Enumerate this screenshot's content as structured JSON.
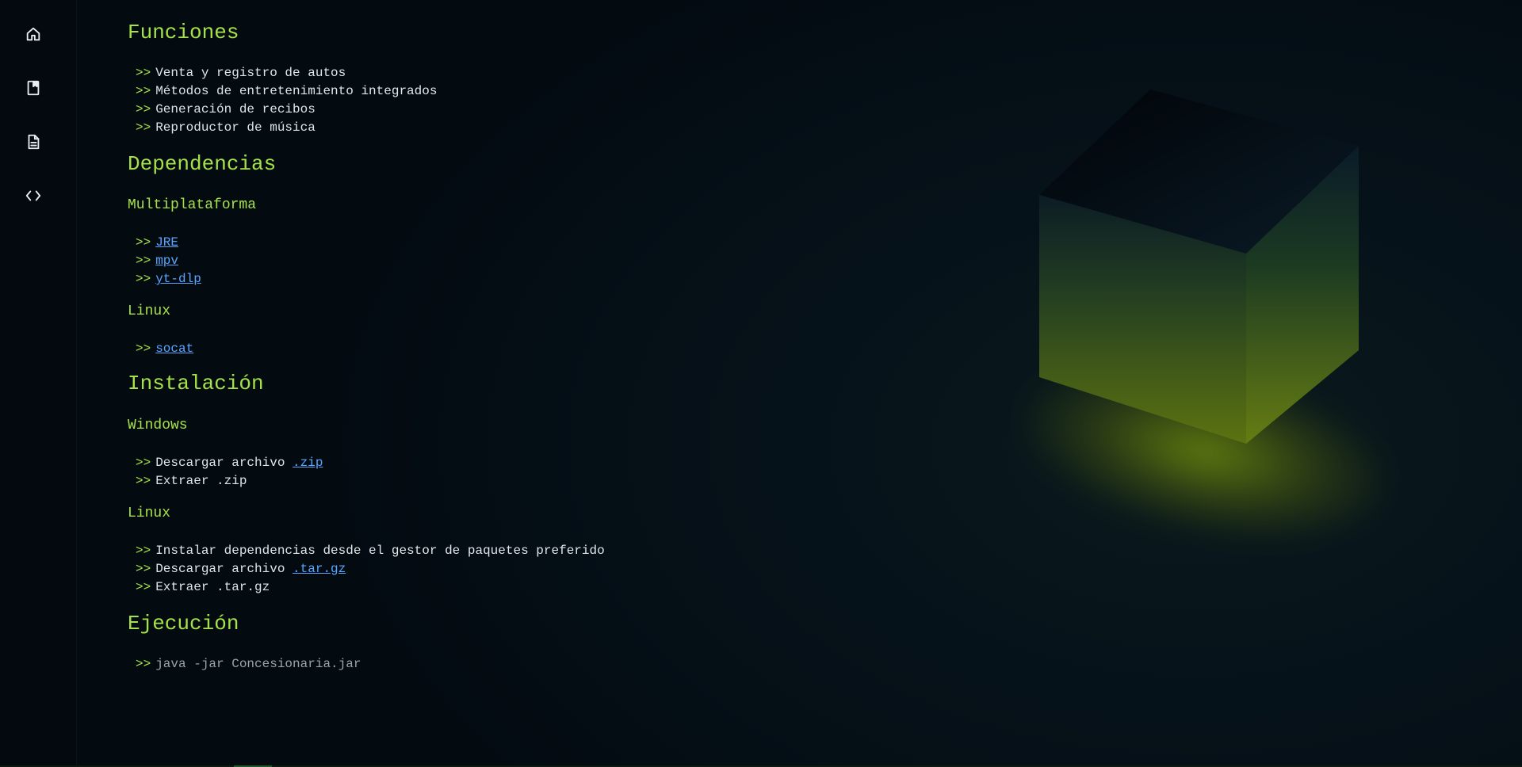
{
  "sidebar": {
    "items": [
      {
        "icon": "home-icon"
      },
      {
        "icon": "book-icon"
      },
      {
        "icon": "document-icon"
      },
      {
        "icon": "code-icon"
      }
    ]
  },
  "sections": {
    "funciones": {
      "title": "Funciones",
      "items": [
        "Venta y registro de autos",
        "Métodos de entretenimiento integrados",
        "Generación de recibos",
        "Reproductor de música"
      ]
    },
    "dependencias": {
      "title": "Dependencias",
      "multiplataforma": {
        "title": "Multiplataforma",
        "links": [
          "JRE",
          "mpv",
          "yt-dlp"
        ]
      },
      "linux": {
        "title": "Linux",
        "links": [
          "socat"
        ]
      }
    },
    "instalacion": {
      "title": "Instalación",
      "windows": {
        "title": "Windows",
        "step1_text": "Descargar archivo",
        "step1_link": ".zip",
        "step2": "Extraer .zip"
      },
      "linux": {
        "title": "Linux",
        "step1": "Instalar dependencias desde el gestor de paquetes preferido",
        "step2_text": "Descargar archivo",
        "step2_link": ".tar.gz",
        "step3": "Extraer .tar.gz"
      }
    },
    "ejecucion": {
      "title": "Ejecución",
      "command": "java -jar Concesionaria.jar"
    }
  },
  "bullet": ">>",
  "colors": {
    "accent": "#a5e24a",
    "link": "#58a6ff",
    "text": "#dfe6e8",
    "background": "#030b11"
  }
}
